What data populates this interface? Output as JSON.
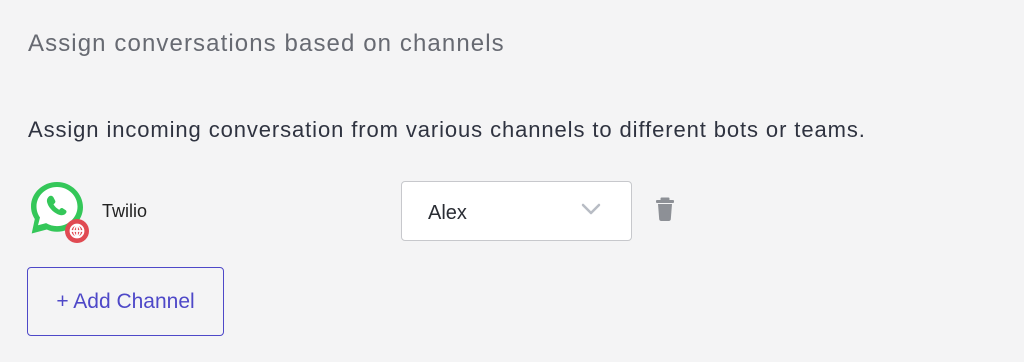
{
  "section": {
    "title": "Assign conversations based on channels",
    "description": "Assign incoming conversation from various channels to different bots or teams."
  },
  "channel_row": {
    "icon": "whatsapp-icon",
    "badge_icon": "globe-badge-icon",
    "name": "Twilio",
    "assignee_select": {
      "selected_value": "Alex",
      "icon": "chevron-down-icon"
    },
    "delete_icon": "trash-icon"
  },
  "actions": {
    "add_channel_label": "+ Add Channel"
  },
  "colors": {
    "page_background": "#f4f4f5",
    "accent": "#4e48c8",
    "whatsapp_green": "#34c759",
    "badge_red": "#e04a52",
    "icon_gray": "#8d9096"
  }
}
